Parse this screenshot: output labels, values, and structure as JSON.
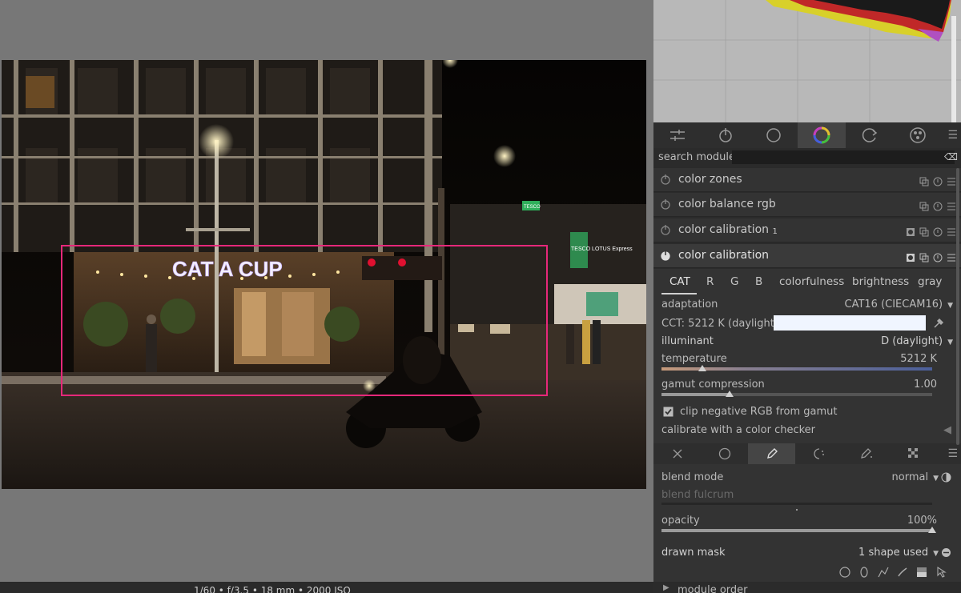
{
  "photo": {
    "sign_text": "CAT  A CUP",
    "small_sign": "TESCO",
    "tesco_sign": "TESCO LOTUS Express"
  },
  "search": {
    "label": "search module",
    "value": ""
  },
  "modules": [
    {
      "name": "color zones",
      "instance": ""
    },
    {
      "name": "color balance rgb",
      "instance": ""
    },
    {
      "name": "color calibration",
      "instance": "1"
    },
    {
      "name": "color calibration",
      "instance": ""
    }
  ],
  "color_calibration": {
    "tabs": [
      "CAT",
      "R",
      "G",
      "B",
      "colorfulness",
      "brightness",
      "gray"
    ],
    "active_tab": "CAT",
    "adaptation_label": "adaptation",
    "adaptation_value": "CAT16 (CIECAM16)",
    "cct_text": "CCT: 5212 K (daylight)",
    "cct_swatch_color": "#f0f5ff",
    "illuminant_label": "illuminant",
    "illuminant_value": "D (daylight)",
    "temperature_label": "temperature",
    "temperature_value": "5212 K",
    "temperature_fraction": 0.15,
    "gamut_label": "gamut compression",
    "gamut_value": "1.00",
    "gamut_fraction": 0.25,
    "clip_label": "clip negative RGB from gamut",
    "clip_checked": true,
    "checker_label": "calibrate with a color checker"
  },
  "blend": {
    "mode_label": "blend mode",
    "mode_value": "normal",
    "fulcrum_label": "blend fulcrum",
    "opacity_label": "opacity",
    "opacity_value": "100%",
    "opacity_fraction": 1.0,
    "mask_label": "drawn mask",
    "mask_value": "1 shape used"
  },
  "bottom": {
    "exif": "1/60 • f/3.5 • 18 mm • 2000 ISO",
    "module_order_label": "module order"
  },
  "colors": {
    "accent_mask": "#e6287a",
    "panel_bg": "#333333",
    "temperature_track_left": "#c79a7a",
    "temperature_track_right": "#4b5f9a"
  }
}
